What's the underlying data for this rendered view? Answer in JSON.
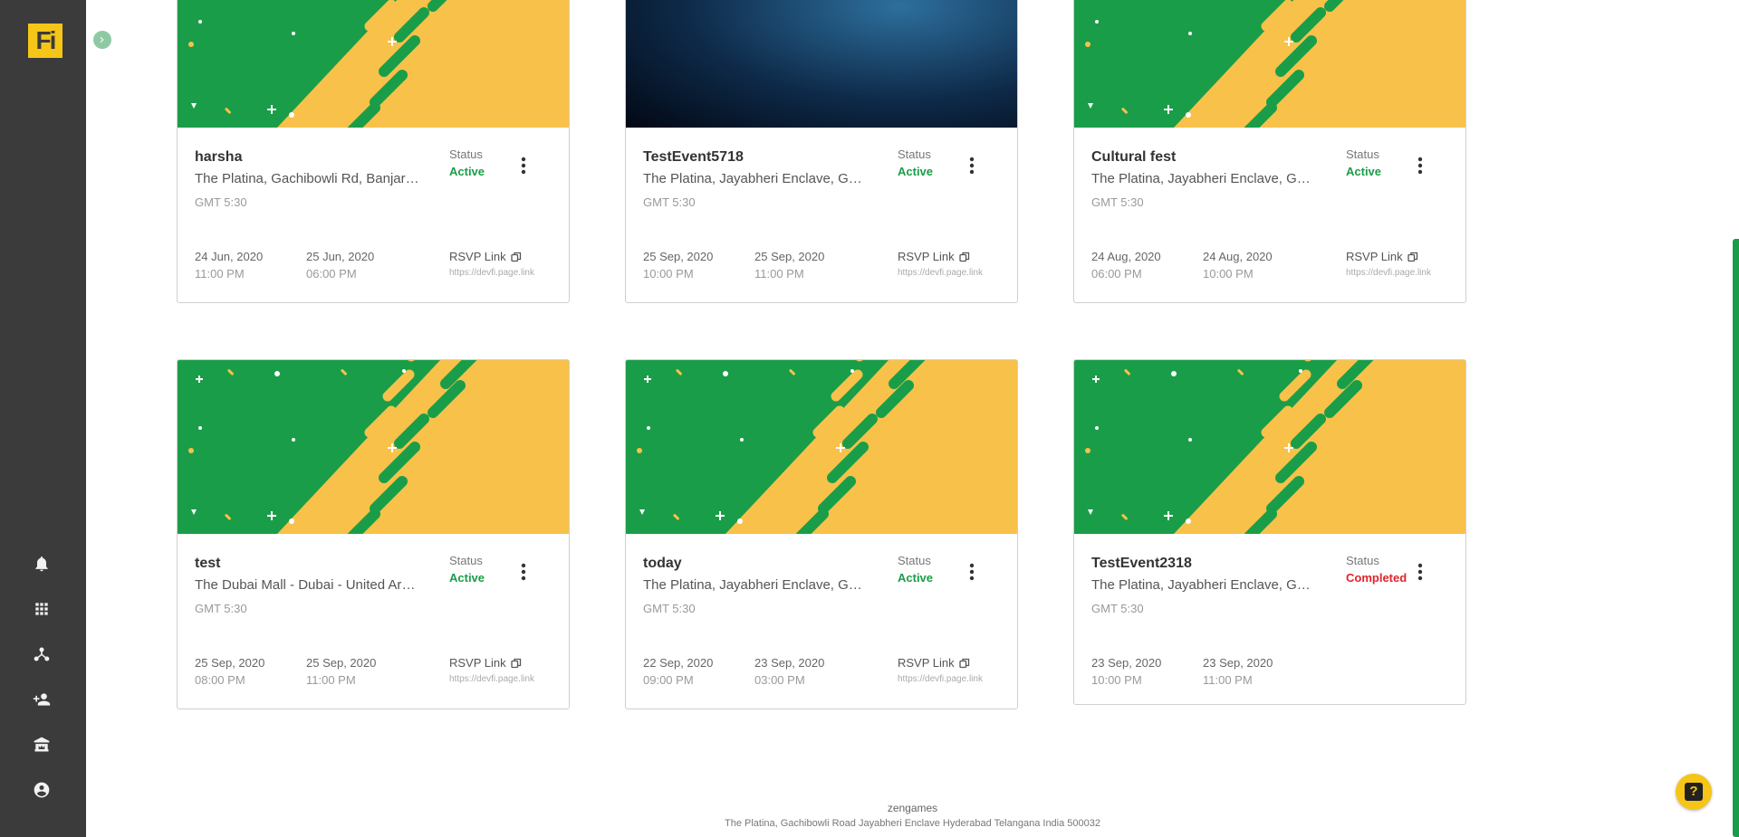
{
  "app": {
    "logo_text": "Fi",
    "brand_color": "#f5c518",
    "accent_color": "#1a9d48",
    "nav_icons": [
      "bell-icon",
      "apps-grid-icon",
      "network-icon",
      "add-user-icon",
      "museum-icon",
      "account-circle-icon"
    ]
  },
  "status_label": "Status",
  "rsvp_label": "RSVP Link",
  "events": [
    {
      "name": "harsha",
      "venue": "The Platina, Gachibowli Rd, Banjara Hills",
      "timezone": "GMT 5:30",
      "status": "Active",
      "start_date": "24 Jun, 2020",
      "start_time": "11:00 PM",
      "end_date": "25 Jun, 2020",
      "end_time": "06:00 PM",
      "rsvp_url": "https://devfi.page.link",
      "banner": "pattern"
    },
    {
      "name": "TestEvent5718",
      "venue": "The Platina, Jayabheri Enclave, Gachibowli",
      "timezone": "GMT 5:30",
      "status": "Active",
      "start_date": "25 Sep, 2020",
      "start_time": "10:00 PM",
      "end_date": "25 Sep, 2020",
      "end_time": "11:00 PM",
      "rsvp_url": "https://devfi.page.link",
      "banner": "photo"
    },
    {
      "name": "Cultural fest",
      "venue": "The Platina, Jayabheri Enclave, Gachibowli",
      "timezone": "GMT 5:30",
      "status": "Active",
      "start_date": "24 Aug, 2020",
      "start_time": "06:00 PM",
      "end_date": "24 Aug, 2020",
      "end_time": "10:00 PM",
      "rsvp_url": "https://devfi.page.link",
      "banner": "pattern"
    },
    {
      "name": "test",
      "venue": "The Dubai Mall - Dubai - United Arab Emirates",
      "timezone": "GMT 5:30",
      "status": "Active",
      "start_date": "25 Sep, 2020",
      "start_time": "08:00 PM",
      "end_date": "25 Sep, 2020",
      "end_time": "11:00 PM",
      "rsvp_url": "https://devfi.page.link",
      "banner": "pattern"
    },
    {
      "name": "today",
      "venue": "The Platina, Jayabheri Enclave, Gachibowli",
      "timezone": "GMT 5:30",
      "status": "Active",
      "start_date": "22 Sep, 2020",
      "start_time": "09:00 PM",
      "end_date": "23 Sep, 2020",
      "end_time": "03:00 PM",
      "rsvp_url": "https://devfi.page.link",
      "banner": "pattern"
    },
    {
      "name": "TestEvent2318",
      "venue": "The Platina, Jayabheri Enclave, Gachibowli",
      "timezone": "GMT 5:30",
      "status": "Completed",
      "start_date": "23 Sep, 2020",
      "start_time": "10:00 PM",
      "end_date": "23 Sep, 2020",
      "end_time": "11:00 PM",
      "rsvp_url": "",
      "banner": "pattern"
    }
  ],
  "footer": {
    "org": "zengames",
    "address": "The Platina, Gachibowli Road Jayabheri Enclave Hyderabad Telangana India 500032"
  },
  "help_label": "?"
}
